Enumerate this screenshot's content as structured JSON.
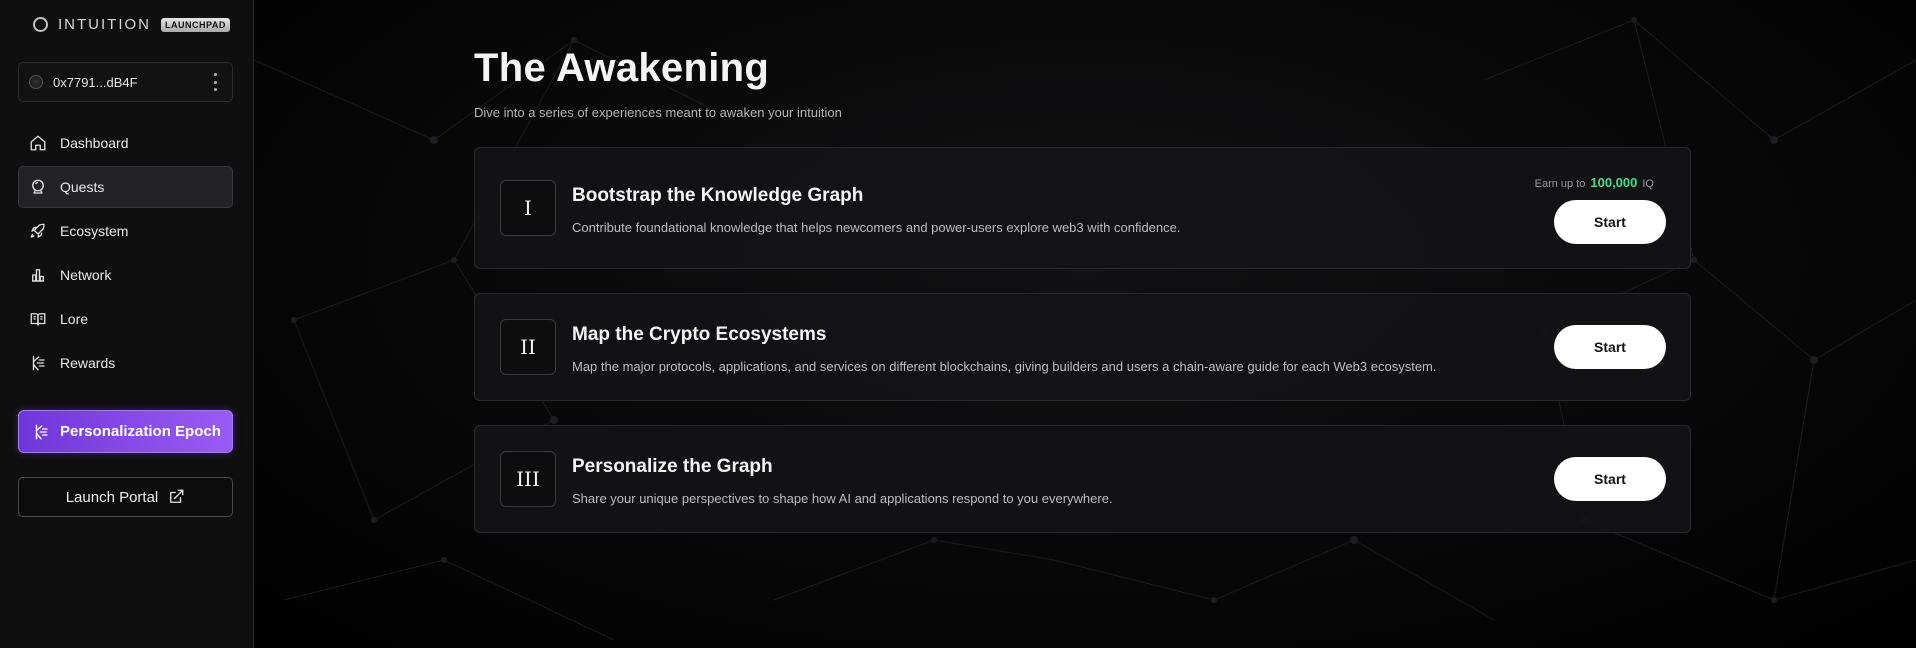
{
  "brand": {
    "name": "INTUITION",
    "badge": "LAUNCHPAD"
  },
  "wallet": {
    "address": "0x7791...dB4F"
  },
  "nav": {
    "items": [
      {
        "label": "Dashboard",
        "icon": "home-icon",
        "active": false
      },
      {
        "label": "Quests",
        "icon": "crystal-ball-icon",
        "active": true
      },
      {
        "label": "Ecosystem",
        "icon": "rocket-icon",
        "active": false
      },
      {
        "label": "Network",
        "icon": "chart-icon",
        "active": false
      },
      {
        "label": "Lore",
        "icon": "book-icon",
        "active": false
      },
      {
        "label": "Rewards",
        "icon": "rewards-icon",
        "active": false
      }
    ]
  },
  "epoch": {
    "label": "Personalization Epoch",
    "icon": "personalization-icon"
  },
  "launch": {
    "label": "Launch Portal",
    "icon": "external-link-icon"
  },
  "page": {
    "title": "The Awakening",
    "subtitle": "Dive into a series of experiences meant to awaken your intuition"
  },
  "quests": [
    {
      "numeral": "I",
      "title": "Bootstrap the Knowledge Graph",
      "description": "Contribute foundational knowledge that helps newcomers and power-users explore web3 with confidence.",
      "reward_prefix": "Earn up to",
      "reward_amount": "100,000",
      "reward_unit": "IQ",
      "start_label": "Start"
    },
    {
      "numeral": "II",
      "title": "Map the Crypto Ecosystems",
      "description": "Map the major protocols, applications, and services on different blockchains, giving builders and users a chain-aware guide for each Web3 ecosystem.",
      "start_label": "Start"
    },
    {
      "numeral": "III",
      "title": "Personalize the Graph",
      "description": "Share your unique perspectives to shape how AI and applications respond to you everywhere.",
      "start_label": "Start"
    }
  ],
  "colors": {
    "accent": "#8b4ff0",
    "reward": "#3ee08f",
    "background": "#000000"
  }
}
